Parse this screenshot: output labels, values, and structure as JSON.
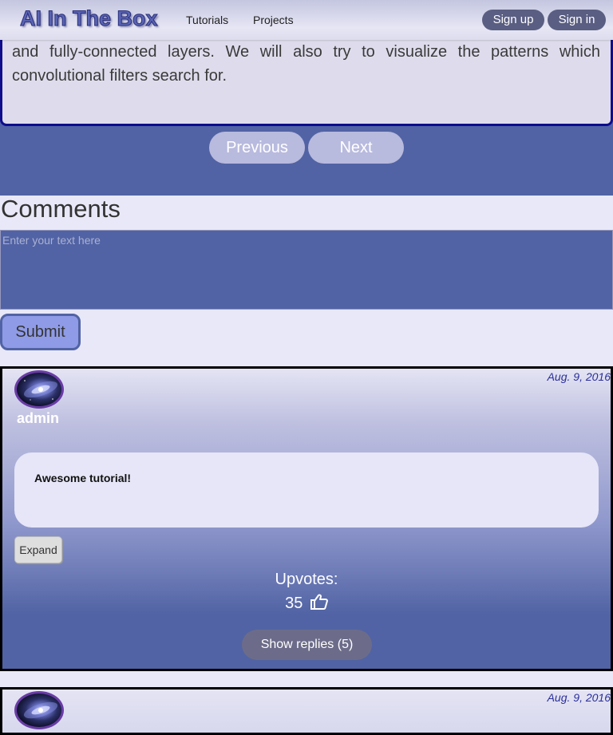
{
  "nav": {
    "brand": "AI In The Box",
    "links": [
      "Tutorials",
      "Projects"
    ],
    "signup": "Sign up",
    "signin": "Sign in"
  },
  "article": {
    "text": "and fully-connected layers. We will also try to visualize the patterns which convolutional filters search for.",
    "prev_label": "Previous",
    "next_label": "Next"
  },
  "comments": {
    "heading": "Comments",
    "placeholder": "Enter your text here",
    "submit_label": "Submit",
    "items": [
      {
        "username": "admin",
        "date": "Aug. 9, 2016",
        "text": "Awesome tutorial!",
        "expand_label": "Expand",
        "upvotes_label": "Upvotes:",
        "upvotes": "35",
        "replies_label": "Show replies (5)"
      },
      {
        "date": "Aug. 9, 2016"
      }
    ]
  },
  "colors": {
    "primary": "#5163a4",
    "page_bg": "#e8e8f8",
    "button_dark": "#5a5e82",
    "pager_button": "#b8bade"
  }
}
